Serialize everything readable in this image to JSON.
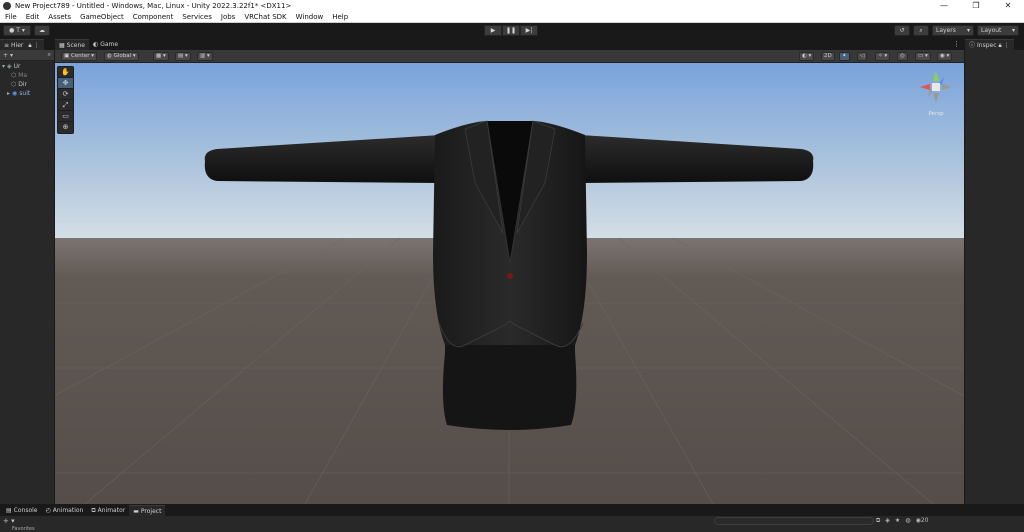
{
  "window": {
    "title": "New Project789 - Untitled - Windows, Mac, Linux - Unity 2022.3.22f1* <DX11>",
    "minimize": "—",
    "maximize": "❐",
    "close": "✕"
  },
  "menu": [
    "File",
    "Edit",
    "Assets",
    "GameObject",
    "Component",
    "Services",
    "Jobs",
    "VRChat SDK",
    "Window",
    "Help"
  ],
  "toolbar": {
    "account_label": "T",
    "cloud_icon": "cloud-icon",
    "layers_label": "Layers",
    "layout_label": "Layout",
    "history_icon": "history-icon",
    "search_icon": "search-icon"
  },
  "hierarchy": {
    "tab_label": "Hier",
    "add_label": "+",
    "items": [
      {
        "label": "Ur",
        "icon": "unity-scene-icon"
      },
      {
        "label": "Ma",
        "icon": "gameobject-icon"
      },
      {
        "label": "Dir",
        "icon": "gameobject-icon"
      },
      {
        "label": "suit",
        "icon": "prefab-icon"
      }
    ]
  },
  "scene": {
    "tabs": [
      {
        "label": "Scene",
        "icon": "scene-grid-icon"
      },
      {
        "label": "Game",
        "icon": "game-controller-icon"
      }
    ],
    "pivot_mode": "Center",
    "pivot_rotation": "Global",
    "toggle_2d": "2D",
    "gizmo_label": "Persp",
    "tools": [
      "view-tool-hand-icon",
      "move-tool-icon",
      "rotate-tool-icon",
      "scale-tool-icon",
      "rect-tool-icon",
      "transform-tool-icon"
    ]
  },
  "inspector": {
    "tab_label": "Inspec"
  },
  "bottom": {
    "tabs": [
      {
        "label": "Console",
        "icon": "console-icon"
      },
      {
        "label": "Animation",
        "icon": "animation-icon"
      },
      {
        "label": "Animator",
        "icon": "animator-icon"
      },
      {
        "label": "Project",
        "icon": "folder-icon"
      }
    ],
    "favorites_label": "Favorites",
    "visible_count": "20"
  },
  "colors": {
    "sky_top": "#7fa6dc",
    "sky_horizon": "#c9d9e6",
    "ground": "#5d5651",
    "panel": "#282828",
    "accent": "#46607c"
  }
}
